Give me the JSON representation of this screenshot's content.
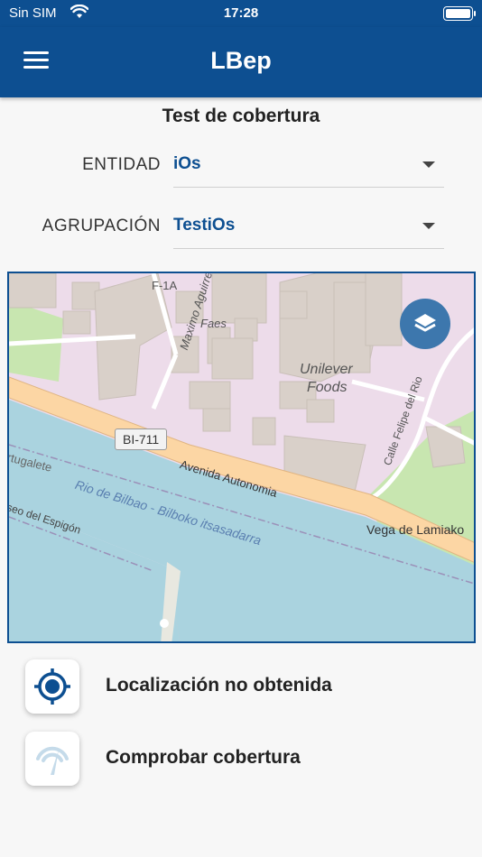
{
  "status_bar": {
    "carrier": "Sin SIM",
    "time": "17:28"
  },
  "app_bar": {
    "title": "LBep"
  },
  "page": {
    "title": "Test de cobertura"
  },
  "fields": {
    "entidad": {
      "label": "ENTIDAD",
      "value": "iOs"
    },
    "agrupacion": {
      "label": "AGRUPACIÓN",
      "value": "TestiOs"
    }
  },
  "map": {
    "labels": {
      "street_maximo": "Maximo Aguirre",
      "faes": "Faes",
      "unilever": "Unilever",
      "foods": "Foods",
      "calle_felipe": "Calle Felipe del Rio",
      "road_ref": "BI-711",
      "avenida": "Avenida Autonomia",
      "vega": "Vega de Lamiako",
      "portugalete": "rtugalete",
      "rio": "Rio de Bilbao - Bilboko itsasadarra",
      "paseo": "seo del Espigón",
      "top_label": "F-1A"
    },
    "colors": {
      "land": "#eddcea",
      "water": "#aad3df",
      "road": "#fcd6a4",
      "building": "#d9d0c9",
      "park": "#c8e6b0"
    }
  },
  "actions": [
    {
      "label": "Localización no obtenida",
      "icon": "crosshair-location-icon"
    },
    {
      "label": "Comprobar cobertura",
      "icon": "signal-gauge-icon"
    }
  ],
  "colors": {
    "primary": "#0d4f91",
    "layers_button": "#3d77ad"
  }
}
